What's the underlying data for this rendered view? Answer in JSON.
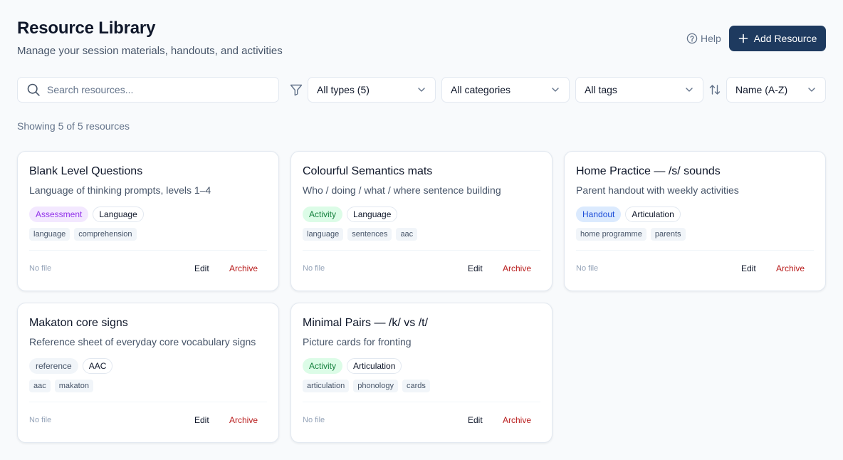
{
  "header": {
    "title": "Resource Library",
    "subtitle": "Manage your session materials, handouts, and activities",
    "help_label": "Help",
    "add_button_label": "Add Resource"
  },
  "toolbar": {
    "search_placeholder": "Search resources...",
    "search_value": "",
    "type_filter": "All types (5)",
    "category_filter": "All categories",
    "tag_filter": "All tags",
    "sort": "Name (A-Z)"
  },
  "result_count": "Showing 5 of 5 resources",
  "colors": {
    "primary": "#1e3a5f",
    "archive": "#b91c1c",
    "assessment_bg": "#f3e8ff",
    "assessment_text": "#9333ea",
    "activity_bg": "#dcfce7",
    "activity_text": "#15803d",
    "handout_bg": "#dbeafe",
    "handout_text": "#1d4ed8",
    "reference_bg": "#f1f5f9",
    "reference_text": "#475569"
  },
  "icons": {
    "help": "help-circle-icon",
    "add": "plus-icon",
    "search": "search-icon",
    "filter": "filter-icon",
    "sort": "sort-icon",
    "dropdown": "chevron-down-icon"
  },
  "resources": [
    {
      "title": "Blank Level Questions",
      "description": "Language of thinking prompts, levels 1–4",
      "type": "Assessment",
      "type_style": "assessment",
      "category": "Language",
      "tags": [
        "language",
        "comprehension"
      ],
      "file_status": "No file",
      "edit_label": "Edit",
      "archive_label": "Archive"
    },
    {
      "title": "Colourful Semantics mats",
      "description": "Who / doing / what / where sentence building",
      "type": "Activity",
      "type_style": "activity",
      "category": "Language",
      "tags": [
        "language",
        "sentences",
        "aac"
      ],
      "file_status": "No file",
      "edit_label": "Edit",
      "archive_label": "Archive"
    },
    {
      "title": "Home Practice — /s/ sounds",
      "description": "Parent handout with weekly activities",
      "type": "Handout",
      "type_style": "handout",
      "category": "Articulation",
      "tags": [
        "home programme",
        "parents"
      ],
      "file_status": "No file",
      "edit_label": "Edit",
      "archive_label": "Archive"
    },
    {
      "title": "Makaton core signs",
      "description": "Reference sheet of everyday core vocabulary signs",
      "type": "reference",
      "type_style": "reference",
      "category": "AAC",
      "tags": [
        "aac",
        "makaton"
      ],
      "file_status": "No file",
      "edit_label": "Edit",
      "archive_label": "Archive"
    },
    {
      "title": "Minimal Pairs — /k/ vs /t/",
      "description": "Picture cards for fronting",
      "type": "Activity",
      "type_style": "activity",
      "category": "Articulation",
      "tags": [
        "articulation",
        "phonology",
        "cards"
      ],
      "file_status": "No file",
      "edit_label": "Edit",
      "archive_label": "Archive"
    }
  ]
}
